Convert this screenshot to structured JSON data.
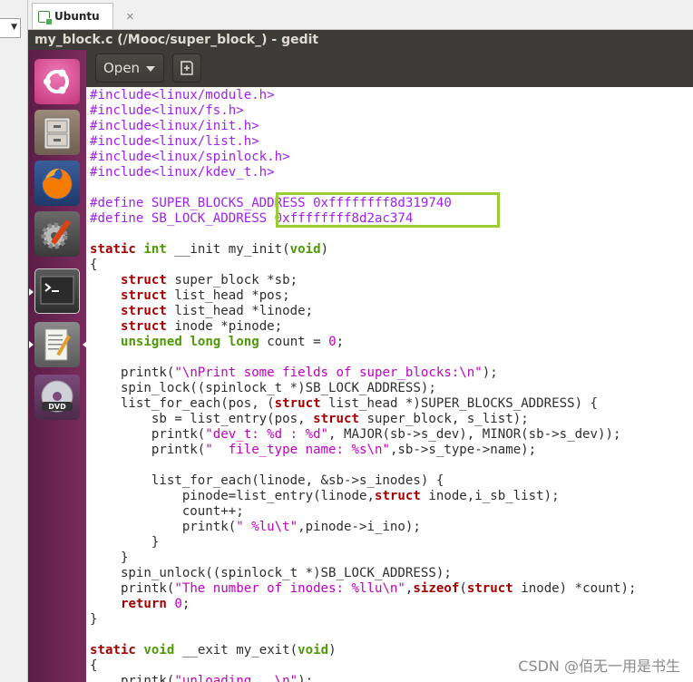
{
  "host": {
    "tab_label": "Ubuntu",
    "tab_close": "✕"
  },
  "window": {
    "title": "my_block.c (/Mooc/super_block_) - gedit"
  },
  "toolbar": {
    "open_label": "Open"
  },
  "launcher": {
    "items": [
      "ubuntu-dash",
      "file-manager",
      "firefox",
      "system-settings",
      "terminal",
      "text-editor",
      "dvd"
    ]
  },
  "code": {
    "lines": [
      "#include<linux/module.h>",
      "#include<linux/fs.h>",
      "#include<linux/init.h>",
      "#include<linux/list.h>",
      "#include<linux/spinlock.h>",
      "#include<linux/kdev_t.h>",
      "",
      "#define SUPER_BLOCKS_ADDRESS 0xffffffff8d319740",
      "#define SB_LOCK_ADDRESS 0xffffffff8d2ac374",
      "",
      "static int __init my_init(void)",
      "{",
      "    struct super_block *sb;",
      "    struct list_head *pos;",
      "    struct list_head *linode;",
      "    struct inode *pinode;",
      "    unsigned long long count = 0;",
      "",
      "    printk(\"\\nPrint some fields of super_blocks:\\n\");",
      "    spin_lock((spinlock_t *)SB_LOCK_ADDRESS);",
      "    list_for_each(pos, (struct list_head *)SUPER_BLOCKS_ADDRESS) {",
      "        sb = list_entry(pos, struct super_block, s_list);",
      "        printk(\"dev_t: %d : %d\", MAJOR(sb->s_dev), MINOR(sb->s_dev));",
      "        printk(\"  file_type name: %s\\n\",sb->s_type->name);",
      "",
      "        list_for_each(linode, &sb->s_inodes) {",
      "            pinode=list_entry(linode,struct inode,i_sb_list);",
      "            count++;",
      "            printk(\" %lu\\t\",pinode->i_ino);",
      "        }",
      "    }",
      "    spin_unlock((spinlock_t *)SB_LOCK_ADDRESS);",
      "    printk(\"The number of inodes: %llu\\n\",sizeof(struct inode) *count);",
      "    return 0;",
      "}",
      "",
      "static void __exit my_exit(void)",
      "{",
      "    printk(\"unloading...\\n\");"
    ]
  },
  "watermark": "CSDN @佰无一用是书生",
  "colors": {
    "keyword": "#a40000",
    "type": "#4e9a06",
    "preprocessor": "#a020f0",
    "string": "#c000c0",
    "launcher": "#6b2253",
    "highlight": "#9acd32"
  }
}
